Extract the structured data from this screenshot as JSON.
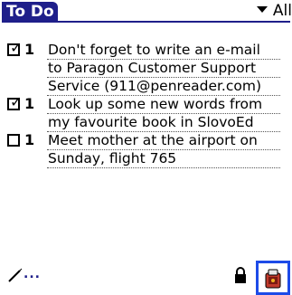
{
  "app": {
    "title": "To Do",
    "category": "All"
  },
  "tasks": [
    {
      "checked": true,
      "priority": "1",
      "lines": [
        "Don't forget to write an e-mail",
        "to Paragon Customer Support",
        "Service (911@penreader.com)"
      ]
    },
    {
      "checked": true,
      "priority": "1",
      "lines": [
        "Look up some new words from",
        "my favourite book in SlovoEd"
      ]
    },
    {
      "checked": false,
      "priority": "1",
      "lines": [
        "Meet mother at the airport on",
        "Sunday, flight 765"
      ]
    }
  ],
  "toolbar": {
    "input_indicator": "...",
    "icons": [
      "pen-icon",
      "lock-icon",
      "app-launcher-icon"
    ],
    "accent_color": "#1d4be8",
    "title_color": "#1f1f8a"
  }
}
